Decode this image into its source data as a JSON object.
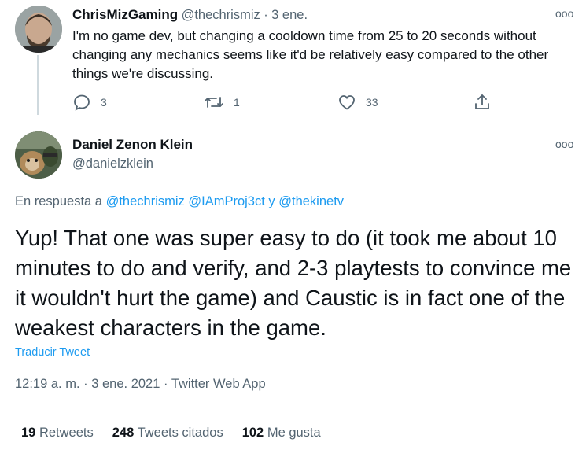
{
  "tweet_reply": {
    "author_name": "ChrisMizGaming",
    "handle": "@thechrismiz",
    "dot": "·",
    "date": "3 ene.",
    "more": "ooo",
    "text": "I'm no game dev, but changing a cooldown time from 25 to 20 seconds without changing any mechanics seems like it'd be relatively easy compared to the other things we're discussing.",
    "actions": {
      "replies": "3",
      "retweets": "1",
      "likes": "33"
    }
  },
  "tweet_main": {
    "author_name": "Daniel Zenon Klein",
    "handle": "@danielzklein",
    "more": "ooo",
    "reply_prefix": "En respuesta a",
    "reply_to_1": "@thechrismiz",
    "reply_to_2": "@IAmProj3ct",
    "reply_and": "y",
    "reply_to_3": "@thekinetv",
    "text": "Yup! That one was super easy to do (it took me about 10 minutes to do and verify, and 2-3 playtests to convince me it wouldn't hurt the game) and Caustic is in fact one of the weakest characters in the game.",
    "translate": "Traducir Tweet",
    "time": "12:19 a. m.",
    "date": "3 ene. 2021",
    "source": "Twitter Web App",
    "stats": {
      "retweets_count": "19",
      "retweets_label": "Retweets",
      "quotes_count": "248",
      "quotes_label": "Tweets citados",
      "likes_count": "102",
      "likes_label": "Me gusta"
    }
  },
  "colors": {
    "accent": "#1d9bf0",
    "muted": "#536471",
    "text": "#0f1419"
  }
}
